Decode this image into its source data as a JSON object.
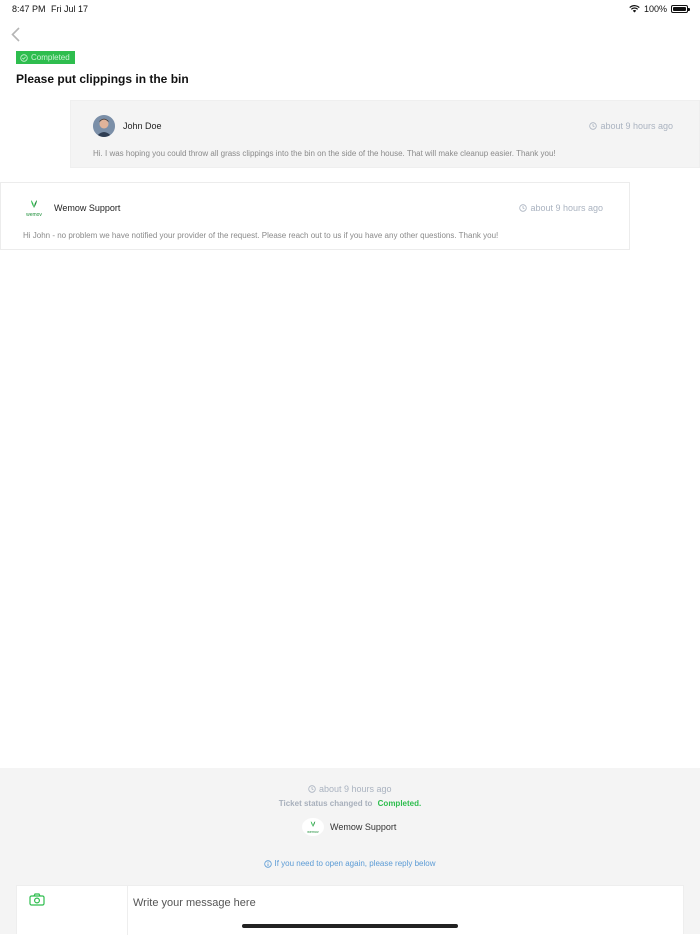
{
  "status_bar": {
    "time": "8:47 PM",
    "date": "Fri Jul 17",
    "battery": "100%"
  },
  "ticket": {
    "status_badge": "Completed",
    "title": "Please put clippings in the bin"
  },
  "messages": [
    {
      "author": "John Doe",
      "time": "about 9 hours ago",
      "body": "Hi. I was hoping you could throw all grass clippings into the bin on the side of the house. That will make cleanup easier. Thank you!"
    },
    {
      "author": "Wemow Support",
      "logo_text": "wemov",
      "time": "about 9 hours ago",
      "body": "Hi John - no problem we have notified your provider of the request.  Please reach out to us if you have any other questions. Thank you!"
    }
  ],
  "status_change": {
    "time": "about 9 hours ago",
    "text": "Ticket status changed to",
    "status": "Completed.",
    "agent": "Wemow Support",
    "reopen_hint": "If you need to open again, please reply below"
  },
  "composer": {
    "placeholder": "Write your message here"
  },
  "colors": {
    "accent_green": "#2ebd4e",
    "link_blue": "#5b9bd5",
    "muted": "#aab3c0"
  },
  "icons": [
    "wifi-icon",
    "battery-icon",
    "back-chevron-icon",
    "check-circle-icon",
    "clock-icon",
    "info-icon",
    "camera-icon"
  ]
}
